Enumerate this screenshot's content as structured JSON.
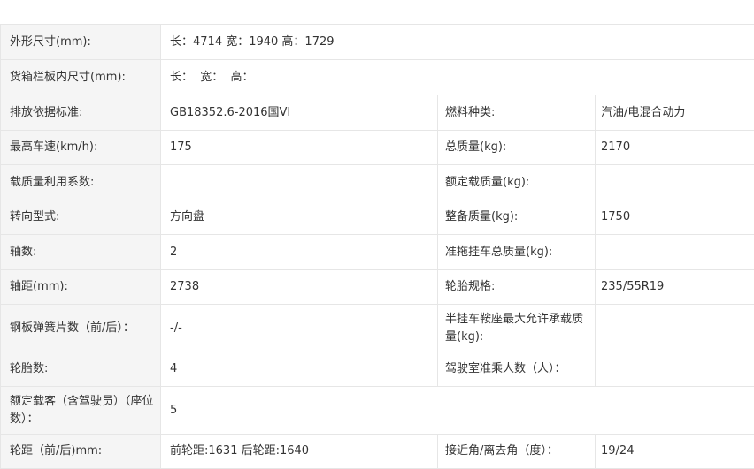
{
  "rows": [
    {
      "l1": "外形尺寸(mm):",
      "v1": "长：4714 宽：1940 高：1729"
    },
    {
      "l1": "货箱栏板内尺寸(mm):",
      "v1": "长：  宽：  高："
    },
    {
      "l1": "排放依据标准:",
      "v1": "GB18352.6-2016国VI",
      "l2": "燃料种类:",
      "v2": "汽油/电混合动力"
    },
    {
      "l1": "最高车速(km/h):",
      "v1": "175",
      "l2": "总质量(kg):",
      "v2": "2170"
    },
    {
      "l1": "载质量利用系数:",
      "v1": "",
      "l2": "额定载质量(kg):",
      "v2": ""
    },
    {
      "l1": "转向型式:",
      "v1": "方向盘",
      "l2": "整备质量(kg):",
      "v2": "1750"
    },
    {
      "l1": "轴数:",
      "v1": "2",
      "l2": "准拖挂车总质量(kg):",
      "v2": ""
    },
    {
      "l1": "轴距(mm):",
      "v1": "2738",
      "l2": "轮胎规格:",
      "v2": "235/55R19"
    },
    {
      "l1": "钢板弹簧片数（前/后）：",
      "v1": "-/-",
      "l2": "半挂车鞍座最大允许承载质量(kg):",
      "v2": ""
    },
    {
      "l1": "轮胎数:",
      "v1": "4",
      "l2": "驾驶室准乘人数（人）：",
      "v2": ""
    },
    {
      "l1": "额定载客（含驾驶员）（座位数）：",
      "v1": "5"
    },
    {
      "l1": "轮距（前/后)mm:",
      "v1": "前轮距:1631 后轮距:1640",
      "l2": "接近角/离去角（度）：",
      "v2": "19/24"
    }
  ]
}
